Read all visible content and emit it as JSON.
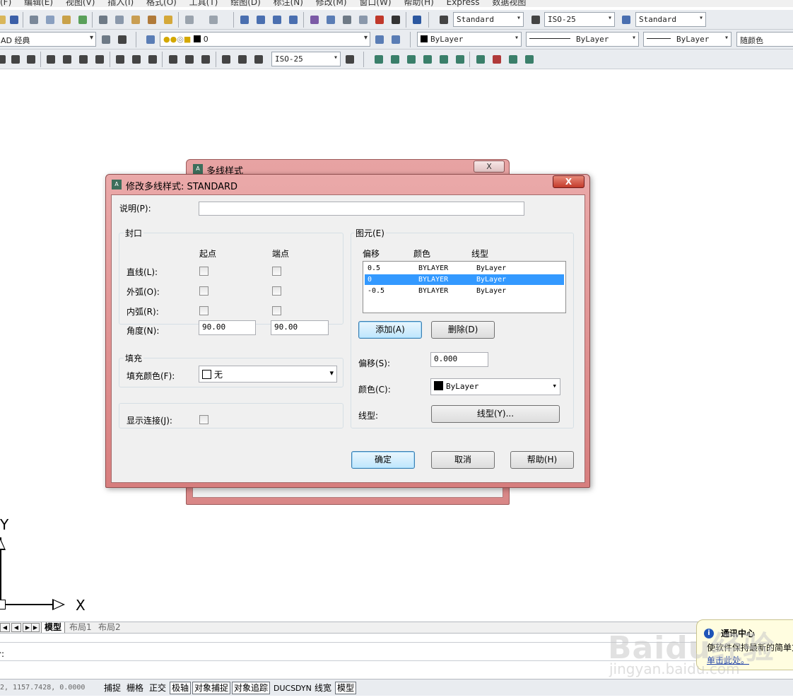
{
  "menubar": {
    "items": [
      "(F)",
      "编辑(E)",
      "视图(V)",
      "插入(I)",
      "格式(O)",
      "工具(T)",
      "绘图(D)",
      "标注(N)",
      "修改(M)",
      "窗口(W)",
      "帮助(H)",
      "Express",
      "数据视图"
    ]
  },
  "toolbar1": {
    "text_style": "Standard",
    "dim_style": "ISO-25",
    "table_style": "Standard"
  },
  "toolbar2": {
    "workspace": "AD 经典",
    "layer": "0",
    "color": "ByLayer",
    "linetype": "ByLayer",
    "lineweight": "ByLayer",
    "plot_style": "随颜色"
  },
  "toolbar3": {
    "dim_style": "ISO-25"
  },
  "drawing": {
    "axis_x_label": "X",
    "axis_y_label": "Y"
  },
  "tabs": {
    "model": "模型",
    "layout1": "布局1",
    "layout2": "布局2"
  },
  "command": {
    "prompt": "令:"
  },
  "status": {
    "coords": "2,  1157.7428, 0.0000",
    "buttons": [
      "捕捉",
      "栅格",
      "正交",
      "极轴",
      "对象捕捉",
      "对象追踪",
      "DUCS",
      "DYN",
      "线宽",
      "模型"
    ]
  },
  "notification": {
    "title": "通讯中心",
    "body": "使软件保持最新的简单方",
    "link": "单击此处。"
  },
  "watermark": {
    "text": "Baidu经验",
    "sub": "jingyan.baidu.com"
  },
  "bg_dialog": {
    "title": "多线样式",
    "close": "X"
  },
  "dialog": {
    "title": "修改多线样式: STANDARD",
    "close": "X",
    "description_label": "说明(P):",
    "description_value": "",
    "caps": {
      "group_label": "封口",
      "start_header": "起点",
      "end_header": "端点",
      "line_label": "直线(L):",
      "outer_arc_label": "外弧(O):",
      "inner_arc_label": "内弧(R):",
      "angle_label": "角度(N):",
      "angle_start": "90.00",
      "angle_end": "90.00"
    },
    "fill": {
      "group_label": "填充",
      "color_label": "填充颜色(F):",
      "color_value": "无"
    },
    "joints": {
      "label": "显示连接(J):"
    },
    "elements": {
      "group_label": "图元(E)",
      "col_offset": "偏移",
      "col_color": "颜色",
      "col_linetype": "线型",
      "rows": [
        {
          "offset": "0.5",
          "color": "BYLAYER",
          "linetype": "ByLayer"
        },
        {
          "offset": "0",
          "color": "BYLAYER",
          "linetype": "ByLayer"
        },
        {
          "offset": "-0.5",
          "color": "BYLAYER",
          "linetype": "ByLayer"
        }
      ],
      "selected_index": 1,
      "add_button": "添加(A)",
      "delete_button": "删除(D)",
      "offset_label": "偏移(S):",
      "offset_value": "0.000",
      "color_label": "颜色(C):",
      "color_value": "ByLayer",
      "linetype_label": "线型:",
      "linetype_button": "线型(Y)..."
    },
    "ok_button": "确定",
    "cancel_button": "取消",
    "help_button": "帮助(H)"
  },
  "colors": {
    "titlebar_pink": "#e59a9a",
    "selection_blue": "#3399ff",
    "link_blue": "#1c3fa8"
  }
}
